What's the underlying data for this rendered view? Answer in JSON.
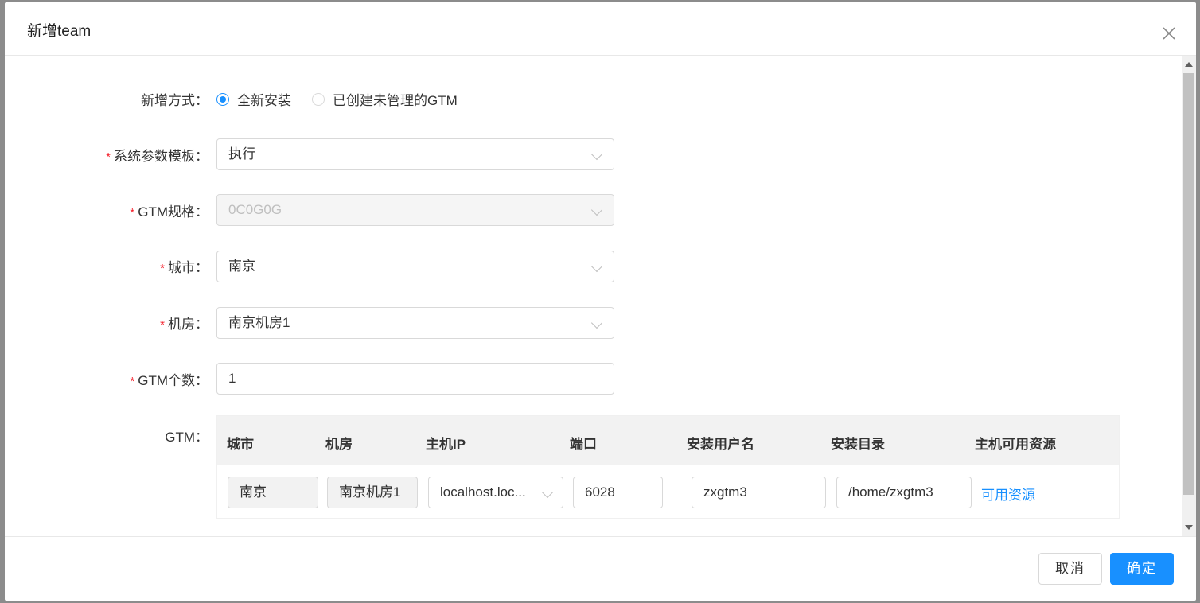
{
  "modal": {
    "title": "新增team"
  },
  "form": {
    "mode": {
      "label": "新增方式：",
      "options": [
        "全新安装",
        "已创建未管理的GTM"
      ],
      "selected_index": 0
    },
    "template": {
      "label": "系统参数模板：",
      "value": "执行",
      "required": true
    },
    "gtm_spec": {
      "label": "GTM规格：",
      "value": "0C0G0G",
      "required": true,
      "disabled": true
    },
    "city": {
      "label": "城市：",
      "value": "南京",
      "required": true
    },
    "room": {
      "label": "机房：",
      "value": "南京机房1",
      "required": true
    },
    "gtm_count": {
      "label": "GTM个数：",
      "value": "1",
      "required": true
    },
    "required_mark": "*",
    "gtm_table": {
      "label": "GTM：",
      "columns": [
        "城市",
        "机房",
        "主机IP",
        "端口",
        "安装用户名",
        "安装目录",
        "主机可用资源"
      ],
      "rows": [
        {
          "city": "南京",
          "room": "南京机房1",
          "host_ip": "localhost.loc...",
          "port": "6028",
          "user": "zxgtm3",
          "dir": "/home/zxgtm3",
          "resource_link": "可用资源"
        }
      ]
    }
  },
  "footer": {
    "cancel_label": "取消",
    "ok_label": "确定"
  },
  "colors": {
    "primary": "#1890ff",
    "required": "#f5222d"
  }
}
